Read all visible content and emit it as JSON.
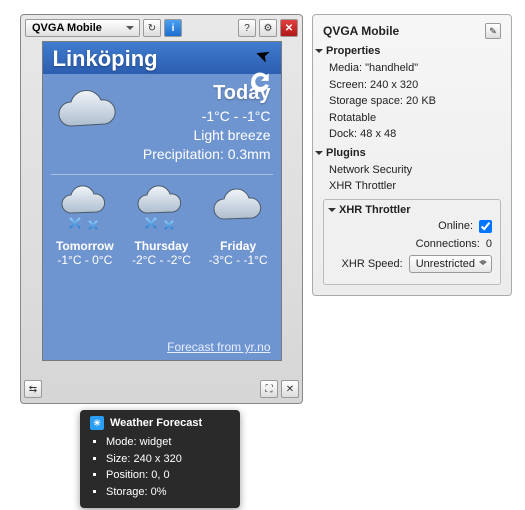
{
  "emulator": {
    "profile_label": "QVGA Mobile",
    "viewport": {
      "city": "Linköping",
      "today": {
        "label": "Today",
        "temps": "-1°C - -1°C",
        "wind": "Light breeze",
        "precip": "Precipitation: 0.3mm"
      },
      "days": [
        {
          "label": "Tomorrow",
          "temps": "-1°C - 0°C",
          "icon": "snow"
        },
        {
          "label": "Thursday",
          "temps": "-2°C - -2°C",
          "icon": "snow"
        },
        {
          "label": "Friday",
          "temps": "-3°C - -1°C",
          "icon": "cloud"
        }
      ],
      "source_link": "Forecast from yr.no"
    }
  },
  "tooltip": {
    "title": "Weather Forecast",
    "items": [
      "Mode: widget",
      "Size: 240 x 320",
      "Position: 0, 0",
      "Storage: 0%"
    ]
  },
  "inspector": {
    "title": "QVGA Mobile",
    "sections": {
      "properties": {
        "label": "Properties",
        "rows": [
          "Media: \"handheld\"",
          "Screen: 240 x 320",
          "Storage space: 20 KB",
          "Rotatable",
          "Dock: 48 x 48"
        ]
      },
      "plugins": {
        "label": "Plugins",
        "rows": [
          "Network Security",
          "XHR Throttler"
        ]
      },
      "xhr": {
        "label": "XHR Throttler",
        "online_label": "Online:",
        "online_checked": true,
        "connections_label": "Connections:",
        "connections_value": "0",
        "speed_label": "XHR Speed:",
        "speed_value": "Unrestricted"
      }
    }
  }
}
